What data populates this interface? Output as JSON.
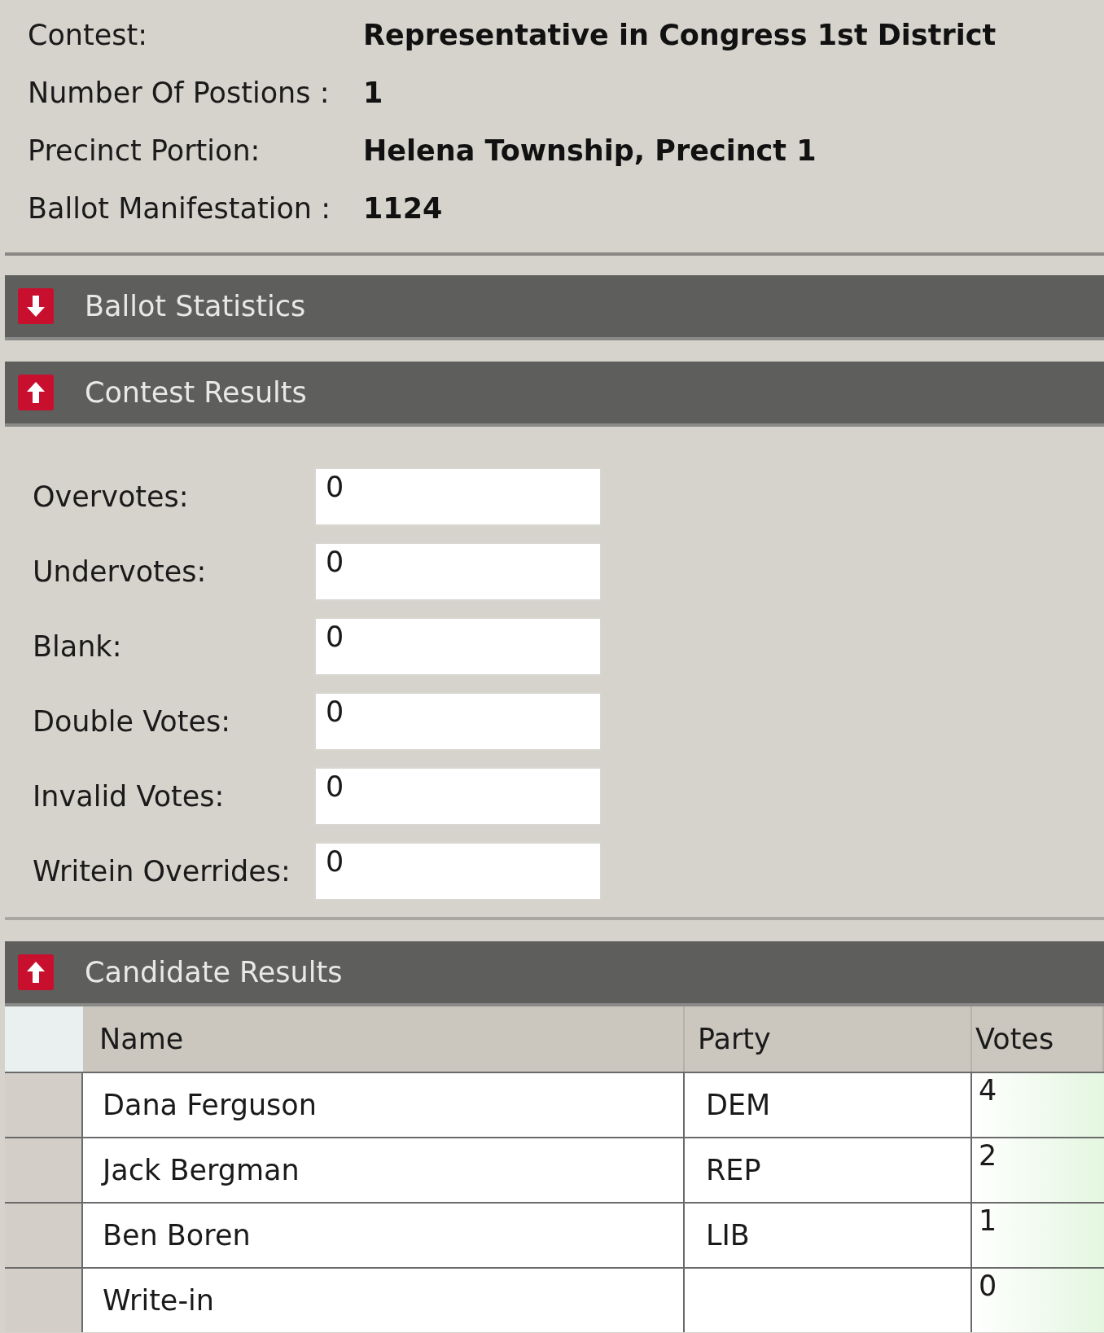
{
  "info": [
    {
      "label": "Contest:",
      "value": "Representative in Congress 1st District"
    },
    {
      "label": "Number Of Postions :",
      "value": "1"
    },
    {
      "label": "Precinct Portion:",
      "value": "Helena Township, Precinct 1"
    },
    {
      "label": "Ballot Manifestation :",
      "value": "1124"
    }
  ],
  "sections": [
    {
      "title": "Ballot Statistics",
      "expanded": false
    },
    {
      "title": "Contest Results",
      "expanded": true,
      "kind": "fields",
      "fields": [
        {
          "label": "Overvotes:",
          "value": "0"
        },
        {
          "label": "Undervotes:",
          "value": "0"
        },
        {
          "label": "Blank:",
          "value": "0"
        },
        {
          "label": "Double Votes:",
          "value": "0"
        },
        {
          "label": "Invalid Votes:",
          "value": "0"
        },
        {
          "label": "Writein Overrides:",
          "value": "0"
        }
      ]
    },
    {
      "title": "Candidate Results",
      "expanded": true,
      "kind": "table",
      "columns": [
        "Name",
        "Party",
        "Votes"
      ],
      "rows": [
        [
          "Dana Ferguson",
          "DEM",
          "4"
        ],
        [
          "Jack Bergman",
          "REP",
          "2"
        ],
        [
          "Ben Boren",
          "LIB",
          "1"
        ],
        [
          "Write-in",
          "",
          "0"
        ]
      ]
    }
  ]
}
